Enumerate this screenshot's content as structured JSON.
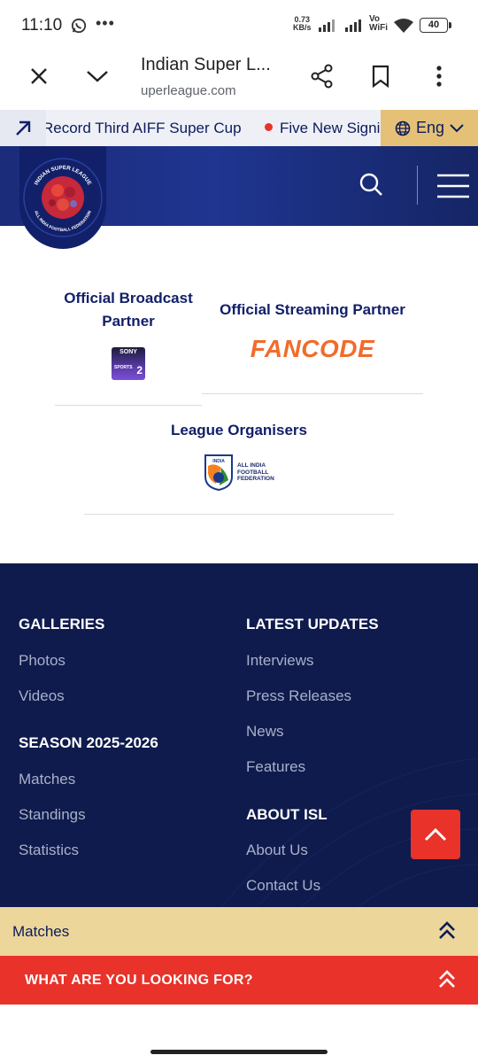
{
  "status_bar": {
    "time": "11:10",
    "net_speed_value": "0.73",
    "net_speed_unit": "KB/s",
    "vo": "Vo",
    "wifi_label": "WiFi",
    "battery": "40"
  },
  "browser": {
    "title": "Indian Super L...",
    "url": "uperleague.com"
  },
  "ticker": {
    "item1": "Record Third AIFF Super Cup",
    "item2": "Five New Signi",
    "language": "Eng"
  },
  "partners": {
    "broadcast_title": "Official Broadcast Partner",
    "broadcast_line1": "Official Broadcast",
    "broadcast_line2": "Partner",
    "streaming_title": "Official Streaming Partner",
    "streaming_logo": "FANCODE",
    "sony_text": "SONY",
    "sony_sub": "SPORTS",
    "sony_num": "2",
    "organisers_title": "League Organisers",
    "aiff_india": "INDIA",
    "aiff_line1": "ALL INDIA",
    "aiff_line2": "FOOTBALL",
    "aiff_line3": "FEDERATION"
  },
  "logo": {
    "top_text": "INDIAN SUPER LEAGUE",
    "bottom_text": "ALL INDIA FOOTBALL FEDERATION"
  },
  "footer": {
    "galleries": {
      "heading": "GALLERIES",
      "links": [
        "Photos",
        "Videos"
      ]
    },
    "season": {
      "heading": "SEASON 2025-2026",
      "links": [
        "Matches",
        "Standings",
        "Statistics"
      ]
    },
    "latest": {
      "heading": "LATEST UPDATES",
      "links": [
        "Interviews",
        "Press Releases",
        "News",
        "Features"
      ]
    },
    "about": {
      "heading": "ABOUT ISL",
      "links": [
        "About Us",
        "Contact Us"
      ]
    }
  },
  "bars": {
    "matches": "Matches",
    "looking": "WHAT ARE YOU LOOKING FOR?"
  },
  "colors": {
    "navy": "#0f1b4d",
    "header_blue": "#1f3590",
    "accent_red": "#e8322a",
    "gold": "#e5c177"
  }
}
